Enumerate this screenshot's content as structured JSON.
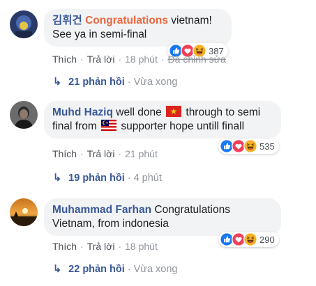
{
  "comments": [
    {
      "author": "김휘건",
      "highlight": "Congratulations",
      "text_line1_rest": " vietnam!",
      "text_line2": "See ya in semi-final",
      "like": "Thích",
      "reply": "Trả lời",
      "time": "18 phút",
      "edited": "Đã chỉnh sửa",
      "reactions_count": "387",
      "reaction_icons": [
        "like-icon",
        "love-icon",
        "haha-icon"
      ],
      "replies_label": "21 phản hồi",
      "replies_time": "Vừa xong"
    },
    {
      "author": "Muhd Haziq",
      "text_a": " well done ",
      "text_b": " through to semi",
      "text_c": "final from ",
      "text_d": " supporter hope untill finall",
      "flags": [
        "vietnam-flag",
        "malaysia-flag"
      ],
      "like": "Thích",
      "reply": "Trả lời",
      "time": "21 phút",
      "reactions_count": "535",
      "reaction_icons": [
        "like-icon",
        "love-icon",
        "haha-icon"
      ],
      "replies_label": "19 phản hồi",
      "replies_time": "4 phút"
    },
    {
      "author": "Muhammad Farhan",
      "text_line1_rest": " Congratulations",
      "text_line2": "Vietnam, from indonesia",
      "like": "Thích",
      "reply": "Trả lời",
      "time": "18 phút",
      "reactions_count": "290",
      "reaction_icons": [
        "like-icon",
        "love-icon",
        "haha-icon"
      ],
      "replies_label": "22 phản hồi",
      "replies_time": "Vừa xong"
    }
  ],
  "colors": {
    "author": "#385898",
    "highlight": "#e9683f",
    "bubble": "#f2f3f5",
    "meta": "#90949c",
    "like_blue": "#1877f2",
    "love_red": "#f33e58",
    "haha_yellow": "#f7b125"
  }
}
